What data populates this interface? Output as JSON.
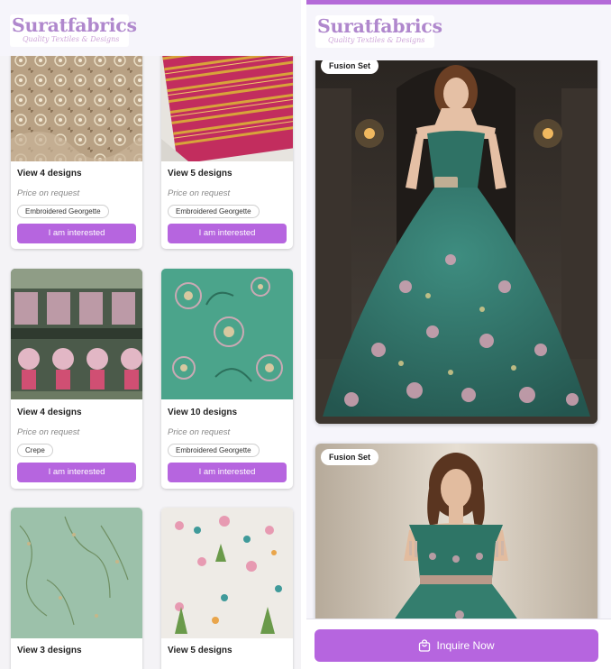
{
  "brand": {
    "name": "Suratfabrics",
    "tagline": "Quality Textiles & Designs",
    "accent_color": "#b665df",
    "logo_color": "#b088cd"
  },
  "catalog": {
    "items": [
      {
        "title": "View 4 designs",
        "price": "Price on request",
        "tag": "Embroidered Georgette",
        "button": "I am interested",
        "image": "gold-sequin-georgette"
      },
      {
        "title": "View 5 designs",
        "price": "Price on request",
        "tag": "Embroidered Georgette",
        "button": "I am interested",
        "image": "pink-gold-stripe-fabric"
      },
      {
        "title": "View 4 designs",
        "price": "Price on request",
        "tag": "Crepe",
        "button": "I am interested",
        "image": "printed-crepe-fabric"
      },
      {
        "title": "View 10 designs",
        "price": "Price on request",
        "tag": "Embroidered Georgette",
        "button": "I am interested",
        "image": "teal-floral-embroidered-fabric"
      },
      {
        "title": "View 3 designs",
        "price": "",
        "tag": "",
        "button": "",
        "image": "mint-embroidered-fabric"
      },
      {
        "title": "View 5 designs",
        "price": "",
        "tag": "",
        "button": "",
        "image": "white-floral-print-fabric"
      }
    ]
  },
  "featured": {
    "products": [
      {
        "badge": "Fusion Set",
        "image": "green-ball-gown"
      },
      {
        "badge": "Fusion Set",
        "image": "green-off-shoulder-gown"
      }
    ],
    "cta": {
      "label": "Inquire Now",
      "icon": "shopping-bag-icon"
    }
  }
}
